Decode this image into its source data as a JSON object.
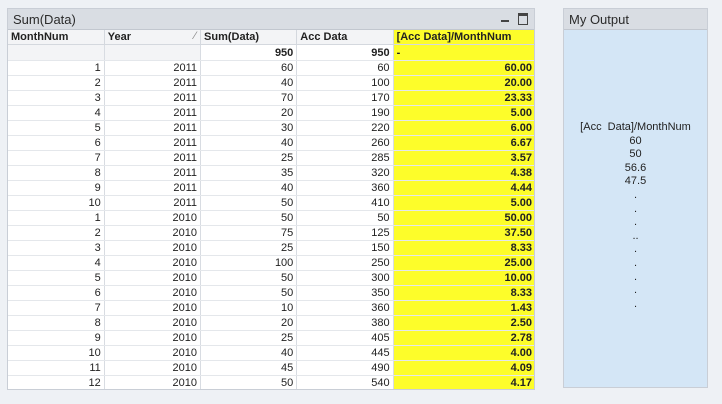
{
  "main_panel": {
    "title": "Sum(Data)",
    "columns": [
      "MonthNum",
      "Year",
      "Sum(Data)",
      "Acc Data",
      "[Acc Data]/MonthNum"
    ],
    "totals": {
      "sum": "950",
      "acc": "950",
      "ratio": "-"
    },
    "rows": [
      [
        "1",
        "2011",
        "60",
        "60",
        "60.00"
      ],
      [
        "2",
        "2011",
        "40",
        "100",
        "20.00"
      ],
      [
        "3",
        "2011",
        "70",
        "170",
        "23.33"
      ],
      [
        "4",
        "2011",
        "20",
        "190",
        "5.00"
      ],
      [
        "5",
        "2011",
        "30",
        "220",
        "6.00"
      ],
      [
        "6",
        "2011",
        "40",
        "260",
        "6.67"
      ],
      [
        "7",
        "2011",
        "25",
        "285",
        "3.57"
      ],
      [
        "8",
        "2011",
        "35",
        "320",
        "4.38"
      ],
      [
        "9",
        "2011",
        "40",
        "360",
        "4.44"
      ],
      [
        "10",
        "2011",
        "50",
        "410",
        "5.00"
      ],
      [
        "1",
        "2010",
        "50",
        "50",
        "50.00"
      ],
      [
        "2",
        "2010",
        "75",
        "125",
        "37.50"
      ],
      [
        "3",
        "2010",
        "25",
        "150",
        "8.33"
      ],
      [
        "4",
        "2010",
        "100",
        "250",
        "25.00"
      ],
      [
        "5",
        "2010",
        "50",
        "300",
        "10.00"
      ],
      [
        "6",
        "2010",
        "50",
        "350",
        "8.33"
      ],
      [
        "7",
        "2010",
        "10",
        "360",
        "1.43"
      ],
      [
        "8",
        "2010",
        "20",
        "380",
        "2.50"
      ],
      [
        "9",
        "2010",
        "25",
        "405",
        "2.78"
      ],
      [
        "10",
        "2010",
        "40",
        "445",
        "4.00"
      ],
      [
        "11",
        "2010",
        "45",
        "490",
        "4.09"
      ],
      [
        "12",
        "2010",
        "50",
        "540",
        "4.17"
      ]
    ]
  },
  "output_panel": {
    "title": "My Output",
    "heading": "[Acc  Data]/MonthNum",
    "values": [
      "60",
      "50",
      "56.6",
      "47.5",
      ".",
      ".",
      ".",
      "..",
      ".",
      ".",
      ".",
      ".",
      "."
    ]
  },
  "colors": {
    "highlight": "#fdfd2a",
    "output_bg": "#d4e6f6",
    "caption_bg": "#d9dde3"
  },
  "icons": [
    "minimize-icon",
    "maximize-icon",
    "sort-icon"
  ]
}
